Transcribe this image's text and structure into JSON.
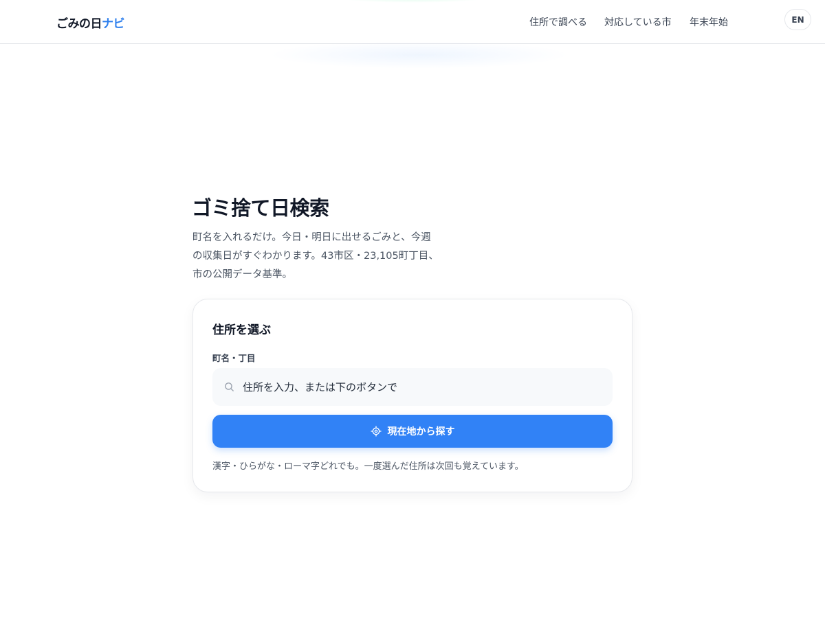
{
  "header": {
    "logo_main": "ごみの日",
    "logo_accent": "ナビ",
    "nav": [
      {
        "label": "住所で調べる"
      },
      {
        "label": "対応している市"
      },
      {
        "label": "年末年始"
      }
    ],
    "lang_label": "EN"
  },
  "hero": {
    "title": "ゴミ捨て日検索",
    "description": "町名を入れるだけ。今日・明日に出せるごみと、今週の収集日がすぐわかります。43市区・23,105町丁目、市の公開データ基準。"
  },
  "card": {
    "title": "住所を選ぶ",
    "field_label": "町名・丁目",
    "search_placeholder": "住所を入力、または下のボタンで",
    "search_value": "",
    "locate_label": "現在地から探す",
    "note": "漢字・ひらがな・ローマ字どれでも。一度選んだ住所は次回も覚えています。"
  },
  "icons": {
    "search": "search-icon",
    "locate": "crosshair-icon"
  },
  "colors": {
    "accent": "#2f80ed",
    "button": "#3182f6",
    "text": "#111827",
    "muted": "#4b5563",
    "border": "#e5e7eb"
  }
}
